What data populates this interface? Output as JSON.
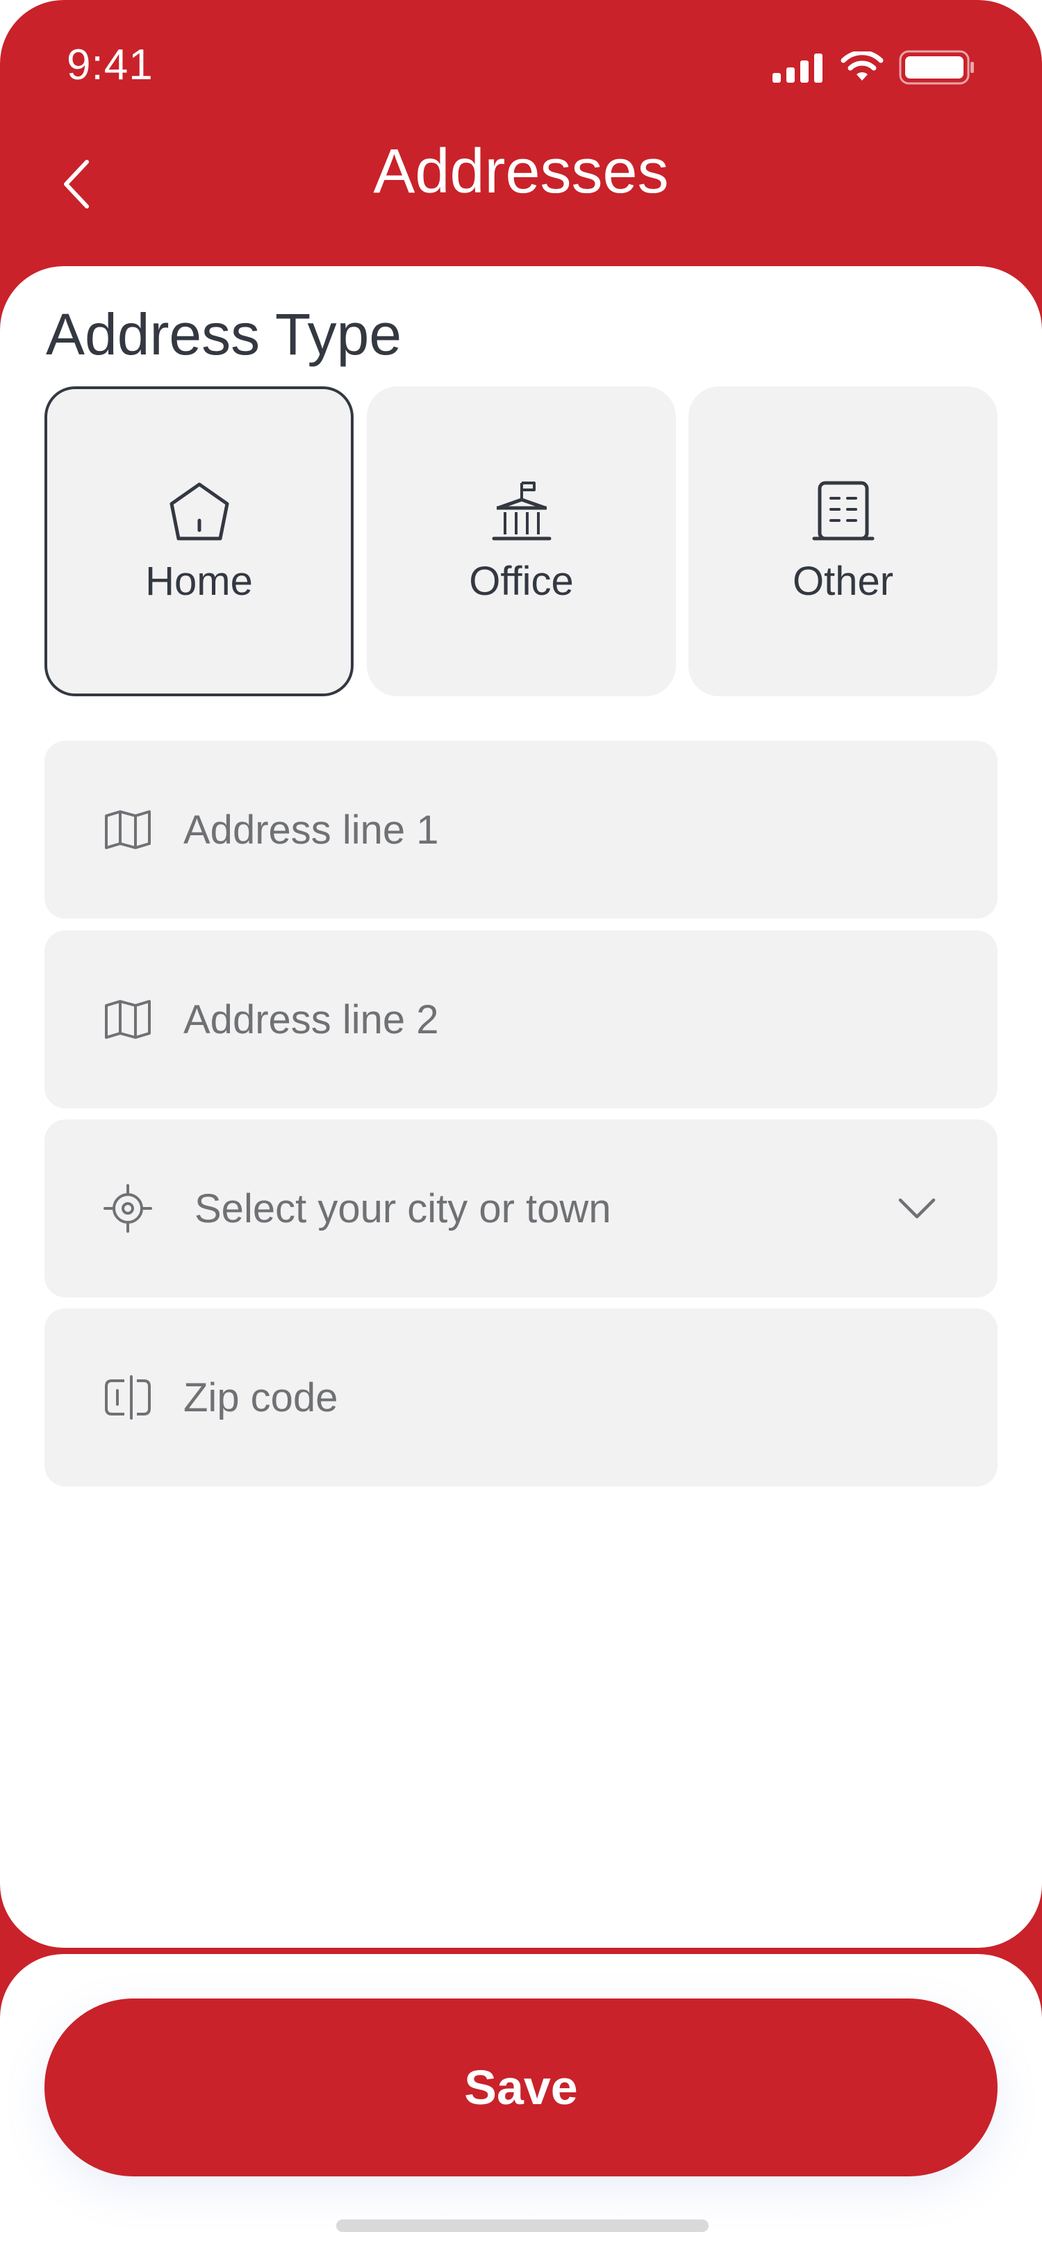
{
  "status_bar": {
    "time": "9:41"
  },
  "header": {
    "title": "Addresses"
  },
  "address_type": {
    "title": "Address Type",
    "options": [
      {
        "label": "Home",
        "icon": "house-icon",
        "selected": true
      },
      {
        "label": "Office",
        "icon": "office-building-icon",
        "selected": false
      },
      {
        "label": "Other",
        "icon": "building-icon",
        "selected": false
      }
    ]
  },
  "fields": {
    "address_line_1": {
      "placeholder": "Address line 1",
      "icon": "map-icon"
    },
    "address_line_2": {
      "placeholder": "Address line 2",
      "icon": "map-icon"
    },
    "city": {
      "placeholder": "Select your city or town",
      "icon": "location-target-icon"
    },
    "zip": {
      "placeholder": "Zip code",
      "icon": "zip-code-icon"
    }
  },
  "actions": {
    "save_label": "Save"
  },
  "colors": {
    "brand": "#C9222A",
    "text": "#333841",
    "field_bg": "#F2F2F3",
    "placeholder": "#6F7175"
  }
}
